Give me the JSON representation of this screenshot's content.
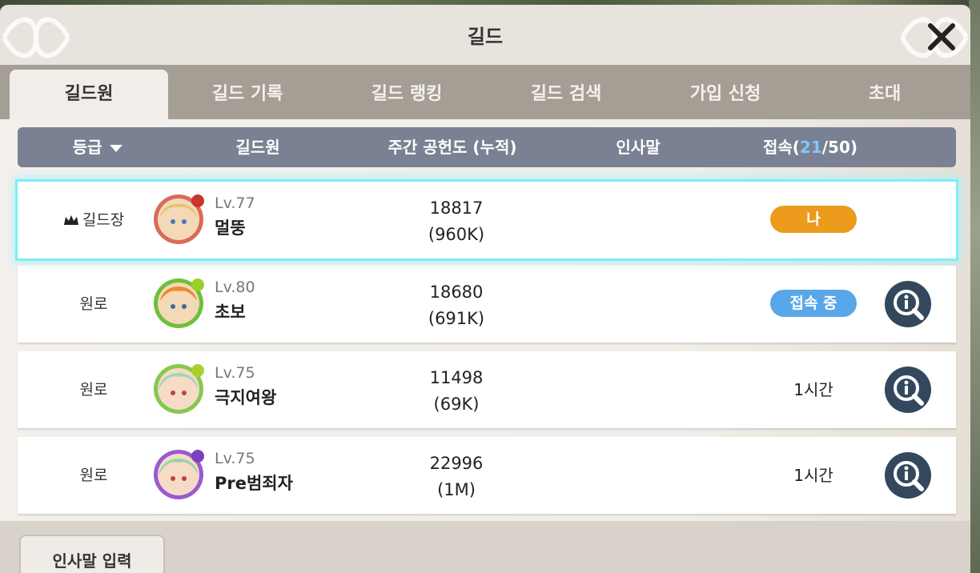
{
  "window": {
    "title": "길드"
  },
  "tabs": [
    {
      "label": "길드원",
      "active": true
    },
    {
      "label": "길드 기록",
      "active": false
    },
    {
      "label": "길드 랭킹",
      "active": false
    },
    {
      "label": "길드 검색",
      "active": false
    },
    {
      "label": "가입 신청",
      "active": false
    },
    {
      "label": "초대",
      "active": false
    }
  ],
  "table": {
    "headers": {
      "grade": "등급",
      "member": "길드원",
      "contribution": "주간 공헌도 (누적)",
      "greeting": "인사말",
      "online_prefix": "접속(",
      "online_count": "21",
      "online_suffix": "/50)"
    },
    "rows": [
      {
        "rank": "길드장",
        "level": "Lv.77",
        "name": "멀뚱",
        "weekly": "18817",
        "total": "(960K)",
        "status": "나",
        "status_type": "me",
        "avatar_color": "#d96b57"
      },
      {
        "rank": "원로",
        "level": "Lv.80",
        "name": "초보",
        "weekly": "18680",
        "total": "(691K)",
        "status": "접속 중",
        "status_type": "online",
        "avatar_color": "#6fbf3a"
      },
      {
        "rank": "원로",
        "level": "Lv.75",
        "name": "극지여왕",
        "weekly": "11498",
        "total": "(69K)",
        "status": "1시간",
        "status_type": "time",
        "avatar_color": "#84c94e"
      },
      {
        "rank": "원로",
        "level": "Lv.75",
        "name": "Pre범죄자",
        "weekly": "22996",
        "total": "(1M)",
        "status": "1시간",
        "status_type": "time",
        "avatar_color": "#9a5ad0"
      }
    ]
  },
  "footer": {
    "greeting_button": "인사말 입력"
  },
  "colors": {
    "header_bg": "#7a8193",
    "accent_count": "#7fc7ff",
    "pill_me": "#ec9b1c",
    "pill_online": "#59a7e8",
    "info_button": "#33485d"
  },
  "icons": {
    "close": "close-icon",
    "info": "magnify-info-icon",
    "crown": "crown-icon",
    "sort": "sort-down-icon"
  }
}
